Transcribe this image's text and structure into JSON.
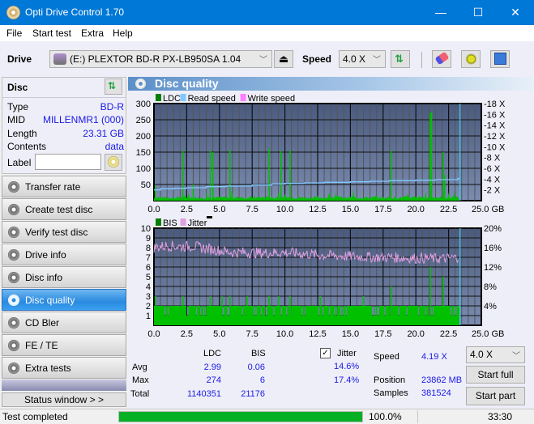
{
  "window": {
    "title": "Opti Drive Control 1.70",
    "minimize": "—",
    "maximize": "☐",
    "close": "✕"
  },
  "menu": [
    "File",
    "Start test",
    "Extra",
    "Help"
  ],
  "toolbar": {
    "drive_label": "Drive",
    "drive_value": "(E:)  PLEXTOR BD-R  PX-LB950SA 1.04",
    "speed_label": "Speed",
    "speed_value": "4.0 X"
  },
  "disc": {
    "header": "Disc",
    "rows": [
      {
        "label": "Type",
        "value": "BD-R"
      },
      {
        "label": "MID",
        "value": "MILLENMR1 (000)"
      },
      {
        "label": "Length",
        "value": "23.31 GB"
      },
      {
        "label": "Contents",
        "value": "data"
      }
    ],
    "label_field": "Label",
    "label_value": ""
  },
  "nav": [
    {
      "label": "Transfer rate",
      "active": false
    },
    {
      "label": "Create test disc",
      "active": false
    },
    {
      "label": "Verify test disc",
      "active": false
    },
    {
      "label": "Drive info",
      "active": false
    },
    {
      "label": "Disc info",
      "active": false
    },
    {
      "label": "Disc quality",
      "active": true
    },
    {
      "label": "CD Bler",
      "active": false
    },
    {
      "label": "FE / TE",
      "active": false
    },
    {
      "label": "Extra tests",
      "active": false
    }
  ],
  "status_window_button": "Status window > >",
  "panel_title": "Disc quality",
  "chart_data": [
    {
      "type": "bar",
      "title": "LDC / Read speed",
      "legend": [
        "LDC",
        "Read speed",
        "Write speed"
      ],
      "legend_colors": [
        "#008000",
        "#80c8ff",
        "#ff80ff"
      ],
      "xlim": [
        0,
        25
      ],
      "x_ticks": [
        "0.0",
        "2.5",
        "5.0",
        "7.5",
        "10.0",
        "12.5",
        "15.0",
        "17.5",
        "20.0",
        "22.5",
        "25.0 GB"
      ],
      "ylim": [
        0,
        300
      ],
      "y_ticks": [
        "50",
        "100",
        "150",
        "200",
        "250",
        "300"
      ],
      "y2lim": [
        0,
        18
      ],
      "y2_ticks": [
        "2 X",
        "4 X",
        "6 X",
        "8 X",
        "10 X",
        "12 X",
        "14 X",
        "16 X",
        "18 X"
      ],
      "grid": true,
      "end_position_gb": 23.31,
      "ldc_spikes": [
        {
          "x": 0.1,
          "y": 45
        },
        {
          "x": 2.2,
          "y": 155
        },
        {
          "x": 3.0,
          "y": 50
        },
        {
          "x": 4.3,
          "y": 155
        },
        {
          "x": 4.5,
          "y": 150
        },
        {
          "x": 5.8,
          "y": 157
        },
        {
          "x": 8.8,
          "y": 162
        },
        {
          "x": 9.7,
          "y": 155
        },
        {
          "x": 10.4,
          "y": 155
        },
        {
          "x": 18.1,
          "y": 155
        },
        {
          "x": 21.1,
          "y": 270
        },
        {
          "x": 21.2,
          "y": 274
        },
        {
          "x": 22.1,
          "y": 150
        },
        {
          "x": 22.2,
          "y": 80
        }
      ],
      "ldc_baseline": 12,
      "read_speed": {
        "x": [
          0,
          0.5,
          1.5,
          2.5,
          4,
          5.5,
          7.5,
          9,
          10,
          11.5,
          13,
          15,
          16.5,
          18,
          20,
          21.5,
          23.2,
          23.31
        ],
        "y": [
          2.0,
          2.2,
          2.3,
          2.4,
          2.6,
          2.7,
          2.9,
          3.1,
          3.2,
          3.3,
          3.4,
          3.5,
          3.6,
          3.7,
          3.8,
          3.9,
          4.1,
          4.19
        ]
      }
    },
    {
      "type": "bar",
      "title": "BIS / Jitter",
      "legend": [
        "BIS",
        "Jitter"
      ],
      "legend_colors": [
        "#008000",
        "#e0a0e0"
      ],
      "xlim": [
        0,
        25
      ],
      "x_ticks": [
        "0.0",
        "2.5",
        "5.0",
        "7.5",
        "10.0",
        "12.5",
        "15.0",
        "17.5",
        "20.0",
        "22.5",
        "25.0 GB"
      ],
      "ylim": [
        0,
        10
      ],
      "y_ticks": [
        "1",
        "2",
        "3",
        "4",
        "5",
        "6",
        "7",
        "8",
        "9",
        "10"
      ],
      "y2lim": [
        0,
        20
      ],
      "y2_ticks": [
        "4%",
        "8%",
        "12%",
        "16%",
        "20%"
      ],
      "grid": true,
      "end_position_gb": 23.31,
      "bis_spikes": [
        {
          "x": 0.1,
          "y": 3
        },
        {
          "x": 2.2,
          "y": 3
        },
        {
          "x": 4.3,
          "y": 3
        },
        {
          "x": 5.2,
          "y": 3
        },
        {
          "x": 5.8,
          "y": 3
        },
        {
          "x": 7.1,
          "y": 3
        },
        {
          "x": 8.8,
          "y": 3
        },
        {
          "x": 9.5,
          "y": 3
        },
        {
          "x": 10.4,
          "y": 3
        },
        {
          "x": 12.7,
          "y": 3
        },
        {
          "x": 16.0,
          "y": 3
        },
        {
          "x": 18.1,
          "y": 4
        },
        {
          "x": 21.1,
          "y": 6
        },
        {
          "x": 22.1,
          "y": 5
        }
      ],
      "jitter_pct": {
        "x": [
          0,
          1,
          2,
          3,
          4,
          5,
          6,
          7,
          8,
          9,
          10,
          11,
          12,
          13,
          14,
          15,
          16,
          17,
          18,
          19,
          20,
          21,
          22,
          23,
          23.31
        ],
        "y": [
          16.0,
          16.4,
          16.2,
          16.3,
          15.8,
          15.4,
          15.0,
          15.0,
          14.9,
          14.9,
          15.0,
          14.8,
          14.6,
          14.4,
          14.3,
          14.2,
          14.1,
          14.0,
          14.0,
          13.9,
          13.8,
          13.8,
          13.7,
          13.9,
          14.2
        ]
      }
    }
  ],
  "stats": {
    "col_ldc": "LDC",
    "col_bis": "BIS",
    "jitter_label": "Jitter",
    "jitter_checked": true,
    "rows": [
      {
        "label": "Avg",
        "ldc": "2.99",
        "bis": "0.06",
        "jitter": "14.6%"
      },
      {
        "label": "Max",
        "ldc": "274",
        "bis": "6",
        "jitter": "17.4%"
      },
      {
        "label": "Total",
        "ldc": "1140351",
        "bis": "21176",
        "jitter": ""
      }
    ],
    "speed_label": "Speed",
    "speed_value": "4.19 X",
    "position_label": "Position",
    "position_value": "23862 MB",
    "samples_label": "Samples",
    "samples_value": "381524",
    "speed_select": "4.0 X",
    "start_full": "Start full",
    "start_part": "Start part"
  },
  "statusbar": {
    "text": "Test completed",
    "progress": 100.0,
    "progress_text": "100.0%",
    "time": "33:30"
  }
}
